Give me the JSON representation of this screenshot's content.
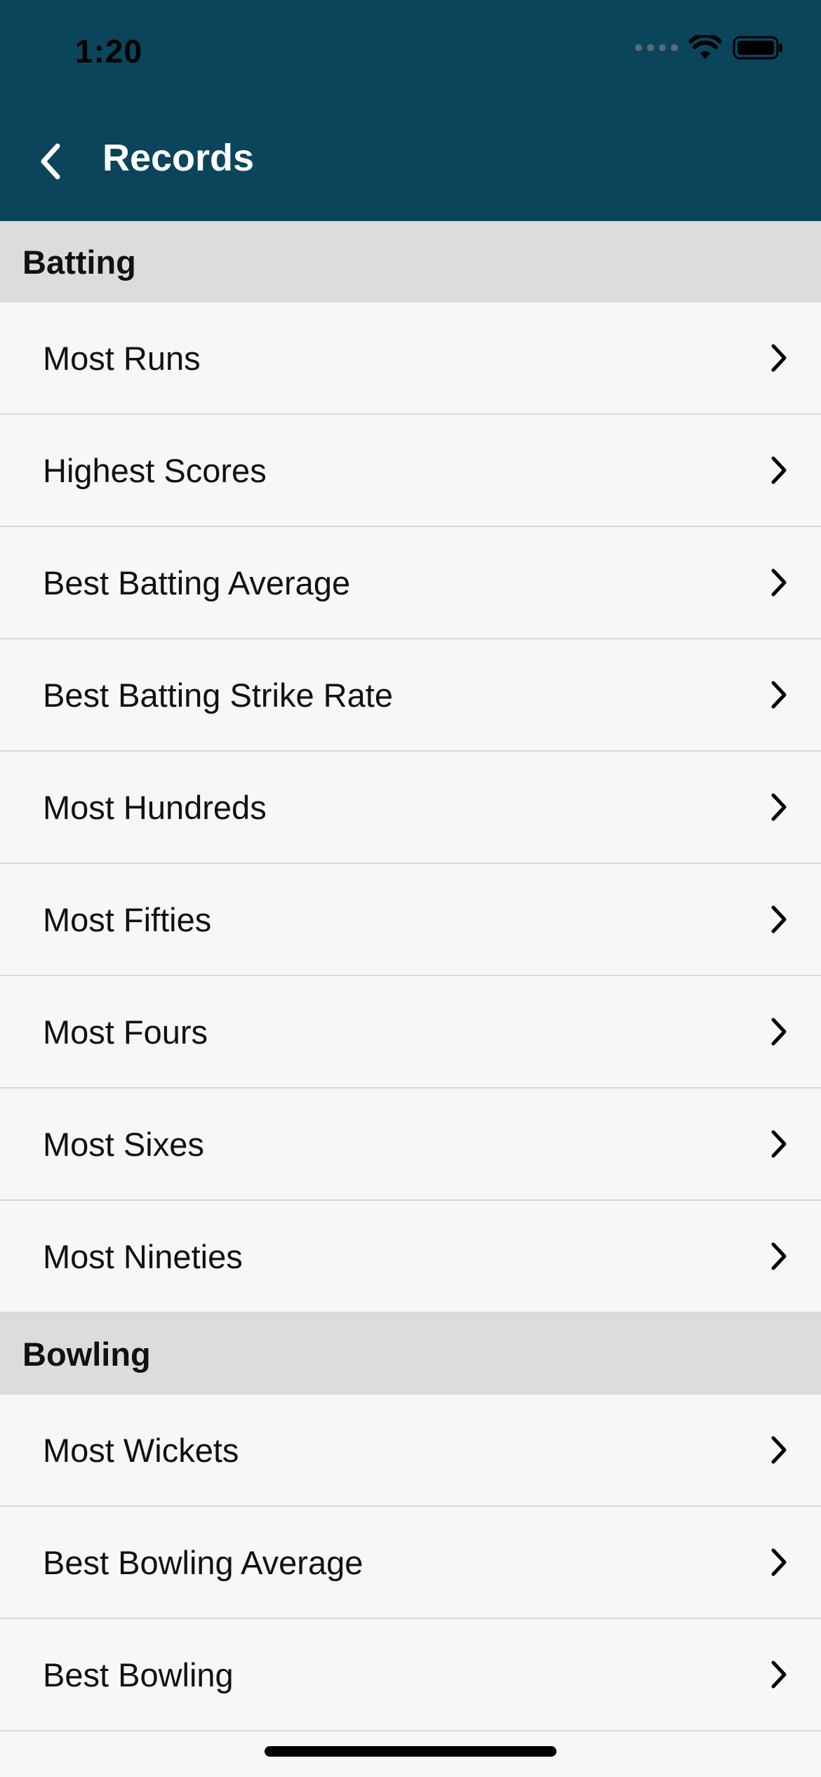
{
  "status_bar": {
    "time": "1:20"
  },
  "nav": {
    "title": "Records"
  },
  "sections": [
    {
      "title": "Batting",
      "items": [
        {
          "label": "Most Runs"
        },
        {
          "label": "Highest Scores"
        },
        {
          "label": "Best Batting Average"
        },
        {
          "label": "Best Batting Strike Rate"
        },
        {
          "label": "Most Hundreds"
        },
        {
          "label": "Most Fifties"
        },
        {
          "label": "Most Fours"
        },
        {
          "label": "Most Sixes"
        },
        {
          "label": "Most Nineties"
        }
      ]
    },
    {
      "title": "Bowling",
      "items": [
        {
          "label": "Most Wickets"
        },
        {
          "label": "Best Bowling Average"
        },
        {
          "label": "Best Bowling"
        }
      ]
    }
  ],
  "colors": {
    "header_bg": "#0b455c",
    "section_bg": "#dcdcdc",
    "row_bg": "#f7f7f7"
  },
  "icons": {
    "back": "chevron-left-icon",
    "row": "chevron-right-icon"
  }
}
